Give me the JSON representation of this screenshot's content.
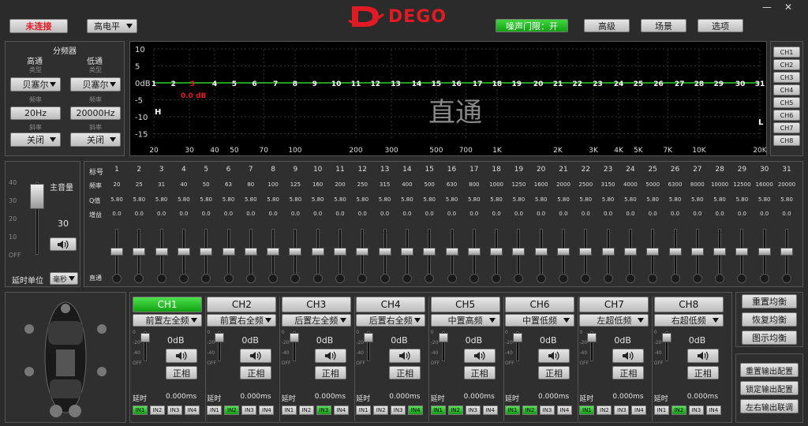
{
  "header": {
    "status": "未连接",
    "level_mode": "高电平",
    "brand": "DEGO",
    "noise_gate": "噪声门限：开",
    "advanced": "高级",
    "scene": "场景",
    "options": "选项",
    "minimize": "—",
    "close": "✕",
    "colors": {
      "brand_red": "#e01b24",
      "green": "#1ea51e"
    }
  },
  "crossover": {
    "title": "分频器",
    "high_title": "高通",
    "low_title": "低通",
    "type_label": "类型",
    "freq_label": "频率",
    "slope_label": "斜率",
    "high_type": "贝塞尔",
    "low_type": "贝塞尔",
    "high_freq": "20Hz",
    "low_freq": "20000Hz",
    "high_slope": "关闭",
    "low_slope": "关闭"
  },
  "graph": {
    "y_labels": [
      "10",
      "5",
      "0dB",
      "-5",
      "-10",
      "-15"
    ],
    "x_labels": [
      "20",
      "30",
      "40",
      "50",
      "70",
      "100",
      "200",
      "300",
      "500",
      "700",
      "1K",
      "2K",
      "3K",
      "4K",
      "5K",
      "7K",
      "10K",
      "20K"
    ],
    "band_numbers": [
      "1",
      "2",
      "3",
      "4",
      "5",
      "6",
      "7",
      "8",
      "9",
      "10",
      "11",
      "12",
      "13",
      "14",
      "15",
      "16",
      "17",
      "18",
      "19",
      "20",
      "21",
      "22",
      "23",
      "24",
      "25",
      "26",
      "27",
      "28",
      "29",
      "30",
      "31"
    ],
    "selected_band": "3",
    "gain_readout": "0.0 dB",
    "watermark": "直通",
    "h_marker": "H",
    "l_marker": "L"
  },
  "channel_tabs": [
    "CH1",
    "CH2",
    "CH3",
    "CH4",
    "CH5",
    "CH6",
    "CH7",
    "CH8"
  ],
  "master": {
    "scale": [
      "40",
      "30",
      "20",
      "10",
      "OFF"
    ],
    "label": "主音量",
    "value": "30",
    "delay_unit_label": "延时单位",
    "delay_unit": "毫秒"
  },
  "eq": {
    "row_labels": {
      "index": "标号",
      "freq": "频率",
      "q": "Q值",
      "gain": "增益",
      "bypass": "直通"
    },
    "bands": [
      {
        "n": "1",
        "f": "20",
        "q": "5.80",
        "g": "0.0"
      },
      {
        "n": "2",
        "f": "25",
        "q": "5.80",
        "g": "0.0"
      },
      {
        "n": "3",
        "f": "31",
        "q": "5.80",
        "g": "0.0"
      },
      {
        "n": "4",
        "f": "40",
        "q": "5.80",
        "g": "0.0"
      },
      {
        "n": "5",
        "f": "50",
        "q": "5.80",
        "g": "0.0"
      },
      {
        "n": "6",
        "f": "63",
        "q": "5.80",
        "g": "0.0"
      },
      {
        "n": "7",
        "f": "80",
        "q": "5.80",
        "g": "0.0"
      },
      {
        "n": "8",
        "f": "100",
        "q": "5.80",
        "g": "0.0"
      },
      {
        "n": "9",
        "f": "125",
        "q": "5.80",
        "g": "0.0"
      },
      {
        "n": "10",
        "f": "160",
        "q": "5.80",
        "g": "0.0"
      },
      {
        "n": "11",
        "f": "200",
        "q": "5.80",
        "g": "0.0"
      },
      {
        "n": "12",
        "f": "250",
        "q": "5.80",
        "g": "0.0"
      },
      {
        "n": "13",
        "f": "315",
        "q": "5.80",
        "g": "0.0"
      },
      {
        "n": "14",
        "f": "400",
        "q": "5.80",
        "g": "0.0"
      },
      {
        "n": "15",
        "f": "500",
        "q": "5.80",
        "g": "0.0"
      },
      {
        "n": "16",
        "f": "630",
        "q": "5.80",
        "g": "0.0"
      },
      {
        "n": "17",
        "f": "800",
        "q": "5.80",
        "g": "0.0"
      },
      {
        "n": "18",
        "f": "1000",
        "q": "5.80",
        "g": "0.0"
      },
      {
        "n": "19",
        "f": "1250",
        "q": "5.80",
        "g": "0.0"
      },
      {
        "n": "20",
        "f": "1600",
        "q": "5.80",
        "g": "0.0"
      },
      {
        "n": "21",
        "f": "2000",
        "q": "5.80",
        "g": "0.0"
      },
      {
        "n": "22",
        "f": "2500",
        "q": "5.80",
        "g": "0.0"
      },
      {
        "n": "23",
        "f": "3150",
        "q": "5.80",
        "g": "0.0"
      },
      {
        "n": "24",
        "f": "4000",
        "q": "5.80",
        "g": "0.0"
      },
      {
        "n": "25",
        "f": "5000",
        "q": "5.80",
        "g": "0.0"
      },
      {
        "n": "26",
        "f": "6300",
        "q": "5.80",
        "g": "0.0"
      },
      {
        "n": "27",
        "f": "8000",
        "q": "5.80",
        "g": "0.0"
      },
      {
        "n": "28",
        "f": "10000",
        "q": "5.80",
        "g": "0.0"
      },
      {
        "n": "29",
        "f": "12500",
        "q": "5.80",
        "g": "0.0"
      },
      {
        "n": "30",
        "f": "16000",
        "q": "5.80",
        "g": "0.0"
      },
      {
        "n": "31",
        "f": "20000",
        "q": "5.80",
        "g": "0.0"
      }
    ]
  },
  "outputs": {
    "db_value": "0dB",
    "phase_label": "正相",
    "delay_label": "延时",
    "delay_value": "0.000ms",
    "fader_scale": [
      "0",
      "-20",
      "-40",
      "OFF"
    ],
    "inputs": [
      "IN1",
      "IN2",
      "IN3",
      "IN4"
    ],
    "channels": [
      {
        "name": "CH1",
        "source": "前置左全频",
        "active": true,
        "input_on": [
          true,
          false,
          false,
          false
        ]
      },
      {
        "name": "CH2",
        "source": "前置右全频",
        "active": false,
        "input_on": [
          false,
          true,
          false,
          false
        ]
      },
      {
        "name": "CH3",
        "source": "后置左全频",
        "active": false,
        "input_on": [
          false,
          false,
          true,
          false
        ]
      },
      {
        "name": "CH4",
        "source": "后置右全频",
        "active": false,
        "input_on": [
          false,
          false,
          false,
          true
        ]
      },
      {
        "name": "CH5",
        "source": "中置高频",
        "active": false,
        "input_on": [
          true,
          true,
          false,
          false
        ]
      },
      {
        "name": "CH6",
        "source": "中置低频",
        "active": false,
        "input_on": [
          true,
          true,
          false,
          false
        ]
      },
      {
        "name": "CH7",
        "source": "左超低频",
        "active": false,
        "input_on": [
          true,
          false,
          false,
          false
        ]
      },
      {
        "name": "CH8",
        "source": "右超低频",
        "active": false,
        "input_on": [
          false,
          true,
          false,
          false
        ]
      }
    ]
  },
  "right_buttons": {
    "reset_eq": "重置均衡",
    "restore_eq": "恢复均衡",
    "show_eq": "图示均衡",
    "reset_out": "重置输出配置",
    "lock_out": "锁定输出配置",
    "link_lr": "左右输出联调"
  }
}
